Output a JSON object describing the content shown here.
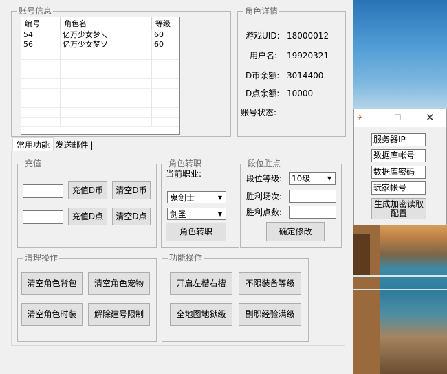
{
  "account_info": {
    "title": "账号信息",
    "columns": [
      "编号",
      "角色名",
      "等级"
    ],
    "rows": [
      {
        "id": "54",
        "name": "亿万少女梦乀",
        "level": "60"
      },
      {
        "id": "56",
        "name": "亿万少女梦ソ",
        "level": "60"
      }
    ]
  },
  "role_detail": {
    "title": "角色详情",
    "game_uid_label": "游戏UID:",
    "game_uid": "18000012",
    "username_label": "用户名:",
    "username": "19920321",
    "d_coin_label": "D币余额:",
    "d_coin": "3014400",
    "d_point_label": "D点余额:",
    "d_point": "10000",
    "status_label": "账号状态:"
  },
  "tabs": [
    "常用功能",
    "发送邮件"
  ],
  "recharge": {
    "title": "充值",
    "recharge_coin": "充值D币",
    "clear_coin": "清空D币",
    "recharge_point": "充值D点",
    "clear_point": "清空D点"
  },
  "job_change": {
    "title": "角色转职",
    "current_job_label": "当前职业:",
    "job_select": "鬼剑士",
    "subjob_select": "剑圣",
    "button": "角色转职"
  },
  "rank": {
    "title": "段位胜点",
    "level_label": "段位等级:",
    "level_value": "10级",
    "wins_label": "胜利场次:",
    "points_label": "胜利点数:",
    "confirm": "确定修改"
  },
  "cleanup": {
    "title": "清理操作",
    "clear_bag": "清空角色背包",
    "clear_pet": "清空角色宠物",
    "clear_fashion": "清空角色时装",
    "remove_limit": "解除建号限制"
  },
  "functions": {
    "title": "功能操作",
    "open_slots": "开启左槽右槽",
    "unlimited_equip": "不限装备等级",
    "map_hell": "全地图地狱级",
    "subjob_max": "副职经验满级"
  },
  "popup": {
    "server_ip": "服务器IP",
    "db_account": "数据库帐号",
    "db_password": "数据库密码",
    "player_account": "玩家帐号",
    "generate": "生成加密读取配置"
  },
  "colors": {
    "window_bg": "#f0f0f0",
    "border": "#b8b8b8",
    "button_bg": "#e1e1e1"
  }
}
